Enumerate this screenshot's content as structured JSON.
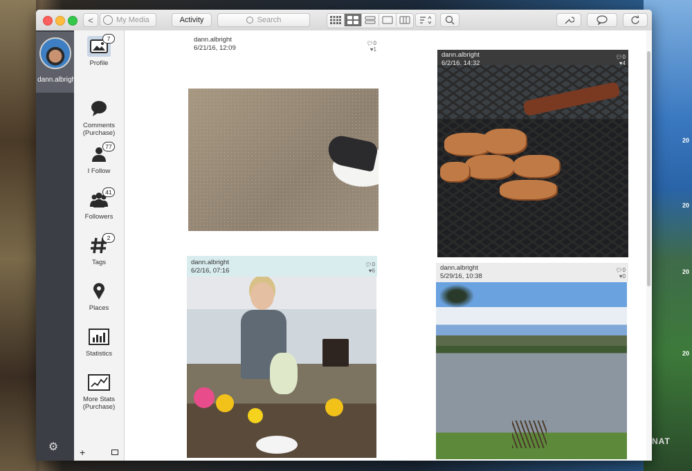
{
  "window": {
    "back_label": "<",
    "my_media_label": "My Media",
    "activity_label": "Activity",
    "search_placeholder": "Search"
  },
  "account": {
    "username": "dann.albright"
  },
  "nav": {
    "items": [
      {
        "label": "Profile",
        "badge": "7",
        "icon": "photo-icon",
        "selected": true
      },
      {
        "label": "Comments (Purchase)",
        "badge": "",
        "icon": "speech-bubble-icon"
      },
      {
        "label": "I Follow",
        "badge": "77",
        "icon": "person-icon"
      },
      {
        "label": "Followers",
        "badge": "41",
        "icon": "people-icon"
      },
      {
        "label": "Tags",
        "badge": "2",
        "icon": "hashtag-icon"
      },
      {
        "label": "Places",
        "badge": "",
        "icon": "map-pin-icon"
      },
      {
        "label": "Statistics",
        "badge": "",
        "icon": "bar-chart-icon"
      },
      {
        "label": "More Stats (Purchase)",
        "badge": "",
        "icon": "line-chart-icon"
      }
    ],
    "footer_add": "+"
  },
  "posts": [
    {
      "user": "dann.albright",
      "date": "6/21/16, 12:09",
      "comments": "0",
      "likes": "1",
      "image": "carpet-and-dog"
    },
    {
      "user": "dann.albright",
      "date": "6/2/16, 14:32",
      "comments": "0",
      "likes": "4",
      "image": "grill-with-meat"
    },
    {
      "user": "dann.albright",
      "date": "6/2/16, 07:16",
      "comments": "0",
      "likes": "6",
      "image": "woman-arranging-flowers"
    },
    {
      "user": "dann.albright",
      "date": "5/29/16, 10:38",
      "comments": "0",
      "likes": "0",
      "image": "mountain-lake"
    }
  ],
  "desktop": {
    "years": [
      "20",
      "20",
      "20",
      "20"
    ],
    "watermark": "NAT"
  },
  "colors": {
    "account_bar": "#3b3e45",
    "sidebar": "#f3f3f4",
    "selected": "#c9d6e6"
  }
}
